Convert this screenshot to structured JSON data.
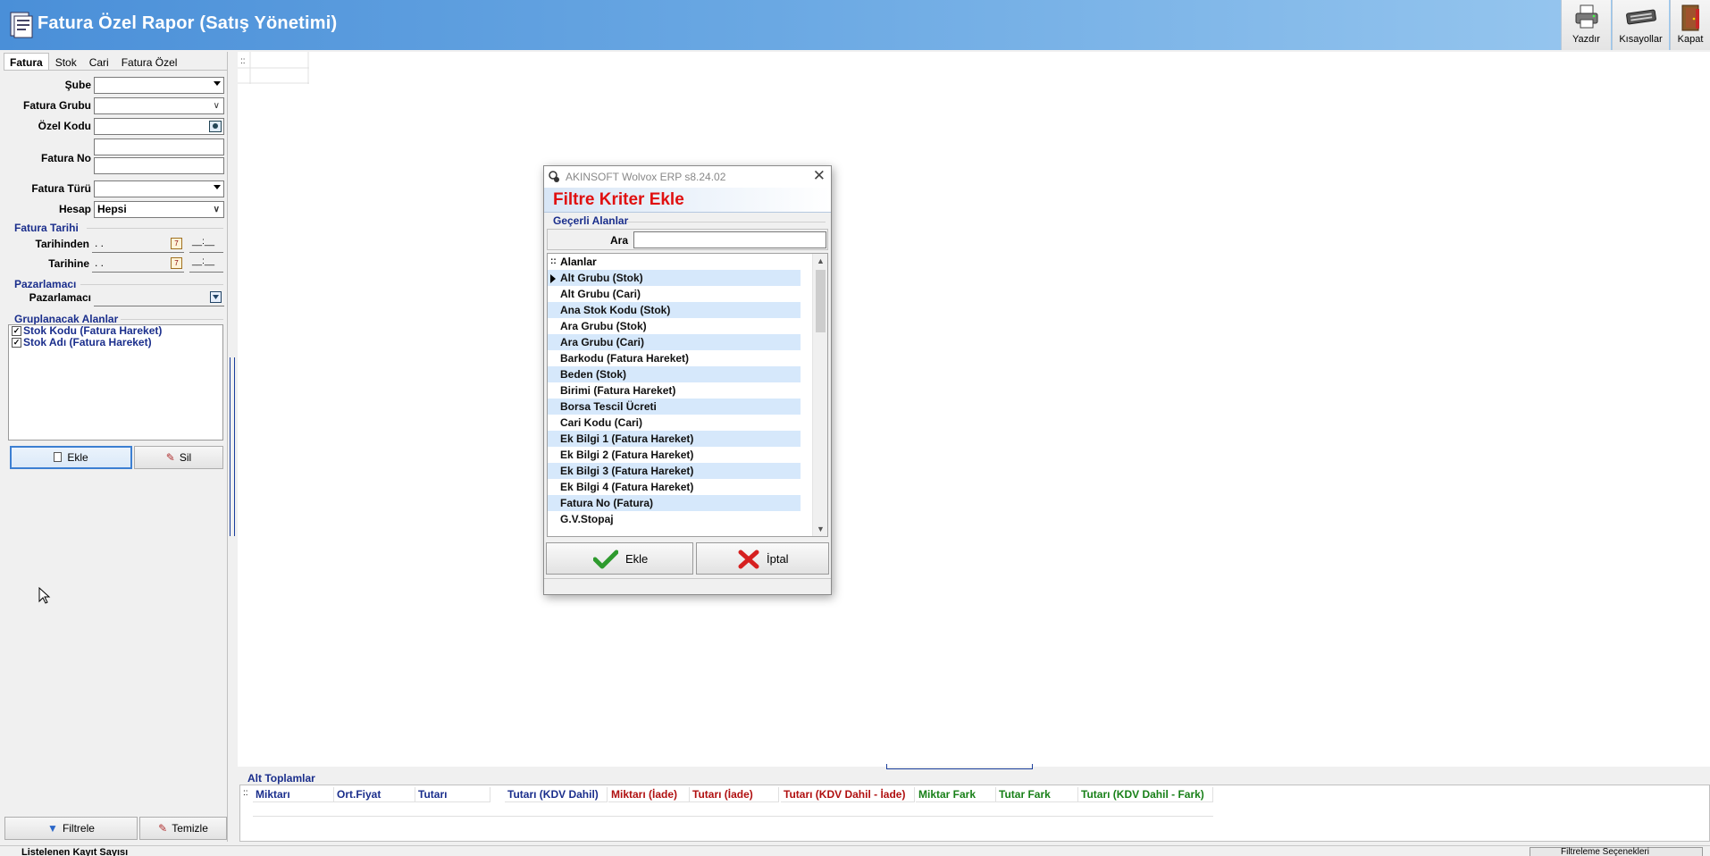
{
  "window": {
    "title": "Fatura Özel Rapor (Satış Yönetimi)"
  },
  "toolbar": {
    "print_label": "Yazdır",
    "shortcuts_label": "Kısayollar",
    "close_label": "Kapat"
  },
  "left_panel": {
    "tabs": [
      "Fatura",
      "Stok",
      "Cari",
      "Fatura Özel"
    ],
    "fields": {
      "sube_label": "Şube",
      "fatura_grubu_label": "Fatura Grubu",
      "ozel_kodu_label": "Özel Kodu",
      "fatura_no_label": "Fatura No",
      "fatura_turu_label": "Fatura Türü",
      "hesap_label": "Hesap",
      "hesap_value": "Hepsi"
    },
    "fatura_tarihi": {
      "group_title": "Fatura Tarihi",
      "from_label": "Tarihinden",
      "to_label": "Tarihine",
      "from_value": ". .",
      "to_value": ". .",
      "from_time": "__:__",
      "to_time": "__:__"
    },
    "pazarlamaci": {
      "group_title": "Pazarlamacı",
      "label": "Pazarlamacı"
    },
    "gruplanacak": {
      "group_title": "Gruplanacak Alanlar",
      "items": [
        "Stok Kodu  (Fatura Hareket)",
        "Stok Adı  (Fatura Hareket)"
      ],
      "add_label": "Ekle",
      "delete_label": "Sil"
    },
    "filter_label": "Filtrele",
    "clear_label": "Temizle"
  },
  "status": {
    "record_count_label": "Listelenen Kayıt Sayısı",
    "filter_options_label": "Filtreleme Seçenekleri"
  },
  "totals": {
    "title": "Alt Toplamlar",
    "columns": [
      {
        "label": "Miktarı",
        "color": "#1a2e8c"
      },
      {
        "label": "Ort.Fiyat",
        "color": "#1a2e8c"
      },
      {
        "label": "Tutarı",
        "color": "#1a2e8c"
      },
      {
        "label": "Tutarı (KDV Dahil)",
        "color": "#1a2e8c"
      },
      {
        "label": "Miktarı (İade)",
        "color": "#b01010"
      },
      {
        "label": "Tutarı (İade)",
        "color": "#b01010"
      },
      {
        "label": "Tutarı (KDV Dahil - İade)",
        "color": "#b01010"
      },
      {
        "label": "Miktar Fark",
        "color": "#188018"
      },
      {
        "label": "Tutar Fark",
        "color": "#188018"
      },
      {
        "label": "Tutarı (KDV Dahil - Fark)",
        "color": "#188018"
      }
    ]
  },
  "dialog": {
    "window_title": "AKINSOFT Wolvox ERP s8.24.02",
    "header": "Filtre Kriter Ekle",
    "section_title": "Geçerli Alanlar",
    "search_label": "Ara",
    "list_header": "Alanlar",
    "items": [
      "Alt Grubu  (Stok)",
      "Alt Grubu (Cari)",
      "Ana Stok Kodu (Stok)",
      "Ara Grubu  (Stok)",
      "Ara Grubu (Cari)",
      "Barkodu (Fatura Hareket)",
      "Beden (Stok)",
      "Birimi  (Fatura Hareket)",
      "Borsa Tescil Ücreti",
      "Cari Kodu (Cari)",
      "Ek Bilgi 1 (Fatura Hareket)",
      "Ek Bilgi 2 (Fatura Hareket)",
      "Ek Bilgi 3 (Fatura Hareket)",
      "Ek Bilgi 4 (Fatura Hareket)",
      "Fatura No  (Fatura)",
      "G.V.Stopaj"
    ],
    "add_label": "Ekle",
    "cancel_label": "İptal"
  }
}
